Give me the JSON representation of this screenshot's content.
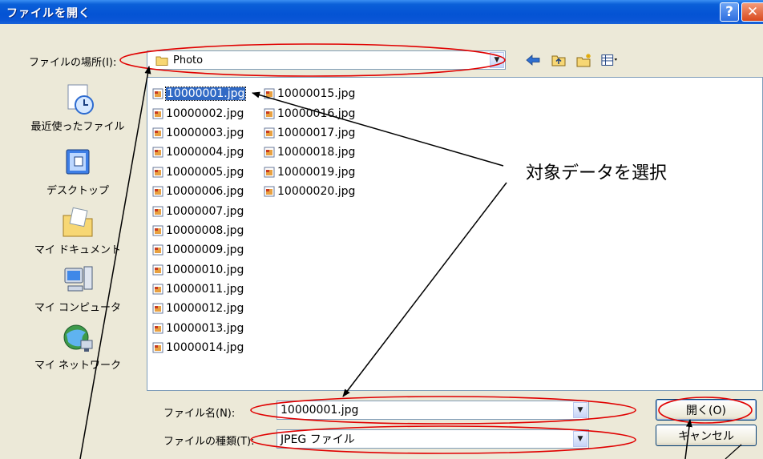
{
  "window": {
    "title": "ファイルを開く",
    "help_glyph": "?",
    "close_glyph": "✕"
  },
  "lookin": {
    "label": "ファイルの場所(I):",
    "value": "Photo"
  },
  "toolbar": {
    "icons": [
      "back-arrow-icon",
      "up-folder-icon",
      "new-folder-icon",
      "view-menu-icon"
    ]
  },
  "places": [
    {
      "label": "最近使ったファイル",
      "icon": "recent-documents-icon"
    },
    {
      "label": "デスクトップ",
      "icon": "desktop-icon"
    },
    {
      "label": "マイ ドキュメント",
      "icon": "my-documents-icon"
    },
    {
      "label": "マイ コンピュータ",
      "icon": "my-computer-icon"
    },
    {
      "label": "マイ ネットワーク",
      "icon": "my-network-icon"
    }
  ],
  "files": {
    "column1": [
      "10000001.jpg",
      "10000002.jpg",
      "10000003.jpg",
      "10000004.jpg",
      "10000005.jpg",
      "10000006.jpg",
      "10000007.jpg",
      "10000008.jpg",
      "10000009.jpg",
      "10000010.jpg",
      "10000011.jpg",
      "10000012.jpg",
      "10000013.jpg",
      "10000014.jpg"
    ],
    "column2": [
      "10000015.jpg",
      "10000016.jpg",
      "10000017.jpg",
      "10000018.jpg",
      "10000019.jpg",
      "10000020.jpg"
    ],
    "selected": "10000001.jpg"
  },
  "filename": {
    "label": "ファイル名(N):",
    "value": "10000001.jpg"
  },
  "filetype": {
    "label": "ファイルの種類(T):",
    "value": "JPEG ファイル"
  },
  "buttons": {
    "open": "開く(O)",
    "cancel": "キャンセル"
  },
  "annotation": {
    "callout": "対象データを選択",
    "color": "#e00000"
  },
  "colors": {
    "title_bar": "#0453d4",
    "selection": "#316ac5",
    "dialog_bg": "#ece9d8"
  }
}
